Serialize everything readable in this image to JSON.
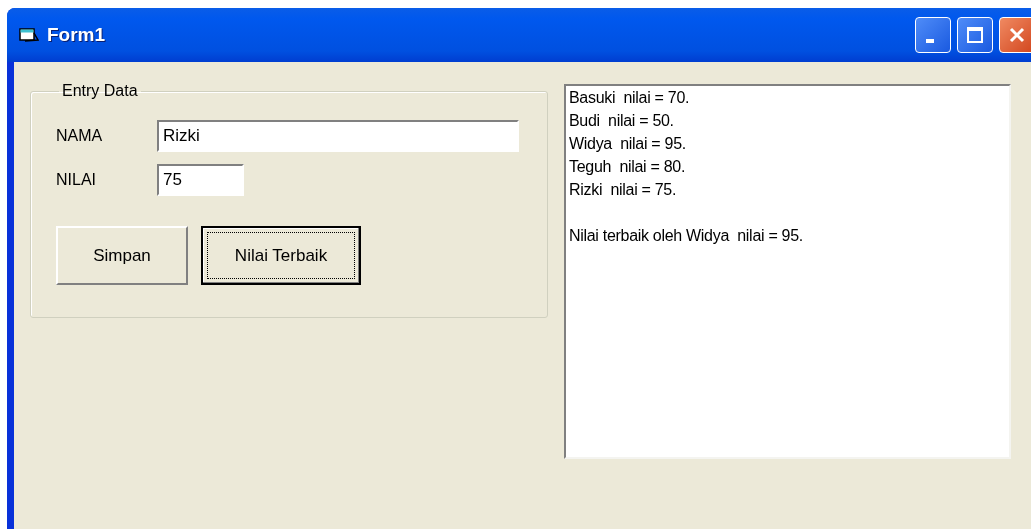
{
  "window": {
    "title": "Form1"
  },
  "entry_group": {
    "legend": "Entry Data",
    "fields": [
      {
        "label": "NAMA",
        "value": "Rizki",
        "kind": "wide"
      },
      {
        "label": "NILAI",
        "value": "75",
        "kind": "narrow"
      }
    ],
    "buttons": [
      {
        "label": "Simpan",
        "focused": false
      },
      {
        "label": "Nilai Terbaik",
        "focused": true
      }
    ]
  },
  "output": {
    "blocks": [
      [
        "Basuki  nilai = 70.",
        "Budi  nilai = 50.",
        "Widya  nilai = 95.",
        "Teguh  nilai = 80.",
        "Rizki  nilai = 75."
      ],
      [
        "Nilai terbaik oleh Widya  nilai = 95."
      ]
    ]
  }
}
